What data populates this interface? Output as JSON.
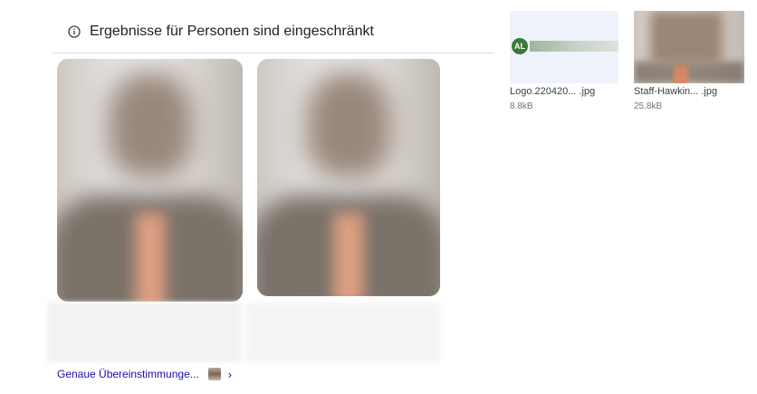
{
  "notice": {
    "icon": "info-icon",
    "message": "Ergebnisse für Personen sind eingeschränkt"
  },
  "images": [
    {
      "kind": "blurred-person-photo"
    },
    {
      "kind": "blurred-person-photo"
    }
  ],
  "exact_match": {
    "label": "Genaue Übereinstimmunge...",
    "chevron": "›"
  },
  "related_files": [
    {
      "name": "Logo.220420... .jpg",
      "size": "8.8kB",
      "logo_text": "AL"
    },
    {
      "name": "Staff-Hawkin... .jpg",
      "size": "25.8kB"
    }
  ],
  "colors": {
    "link": "#1a0dab",
    "divider": "#dadce0",
    "muted_text": "#70757a"
  }
}
